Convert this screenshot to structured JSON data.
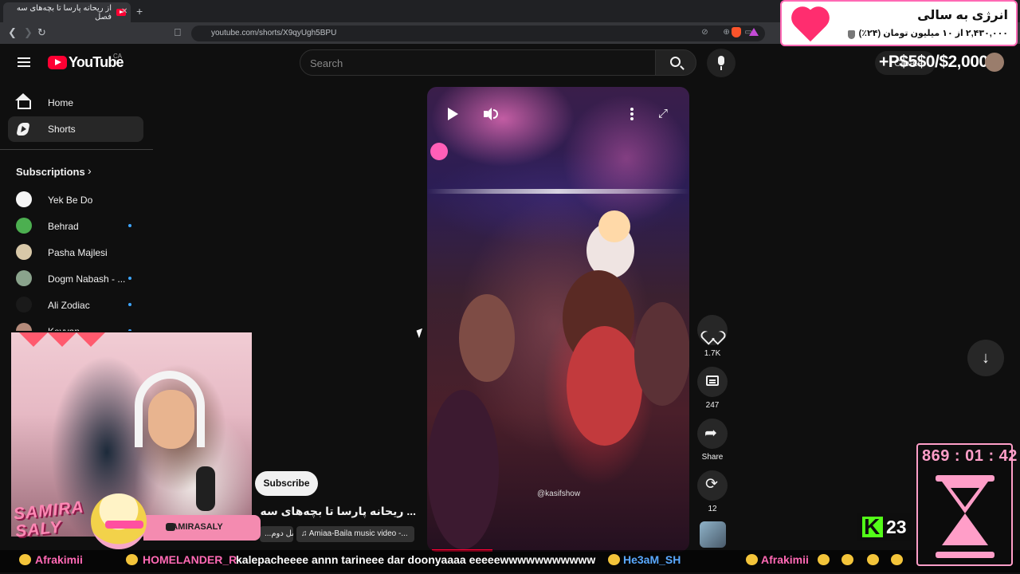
{
  "browser": {
    "tab_title": "از ریحانه پارسا تا بچه‌های سه فصل",
    "new_tab": "+",
    "url": "youtube.com/shorts/X9qyUgh5BPU"
  },
  "masthead": {
    "logo_text": "YouTube",
    "region": "CA",
    "search_placeholder": "Search",
    "create_label": "Create",
    "overlay_amount": "+P$5$0/$2,000"
  },
  "sidebar": {
    "items": [
      {
        "label": "Home"
      },
      {
        "label": "Shorts"
      }
    ],
    "subscriptions_label": "Subscriptions",
    "subscriptions": [
      {
        "name": "Yek Be Do",
        "color": "#f5f5f5",
        "new": false
      },
      {
        "name": "Behrad",
        "color": "#4caf50",
        "new": true
      },
      {
        "name": "Pasha Majlesi",
        "color": "#d8c8a8",
        "new": false
      },
      {
        "name": "Dogm Nabash - ...",
        "color": "#8aa38c",
        "new": true
      },
      {
        "name": "Ali Zodiac",
        "color": "#1a1a1a",
        "new": true
      },
      {
        "name": "Keyvan",
        "color": "#b48a7a",
        "new": true
      }
    ]
  },
  "short": {
    "watermark": "@kasifshow",
    "progress": 0.24,
    "likes": "1.7K",
    "comments": "247",
    "share_label": "Share",
    "remix_count": "12",
    "subscribe_label": "Subscribe",
    "title": "... ریحانه پارسا تا بچه‌های سه فصل",
    "chip_channel": "...سل دوم",
    "chip_music": "Amiaa-Baila music video -..."
  },
  "donation": {
    "title": "انرژی به سالی",
    "subtitle": "۲,۴۳۰,۰۰۰ از ۱۰ میلیون تومان (۲۴٪)"
  },
  "stream": {
    "streamer_name_line1": "SAMIRA",
    "streamer_name_line2": "SALY",
    "social_handle": "SAMIRASALY",
    "kick_followers": "23",
    "timer": "869 : 01 : 42"
  },
  "chat_ticker": [
    {
      "user": "Afrakimii",
      "color": "#ff69b4",
      "message": ""
    },
    {
      "user": "HOMELANDER_R",
      "color": "#ff69b4",
      "message": "kalepacheeee annn tarineee dar doonyaaaa eeeeewwwwwwwwwww"
    },
    {
      "user": "He3aM_SH",
      "color": "#5aa9ff",
      "message": ""
    },
    {
      "user": "Afrakimii",
      "color": "#ff69b4",
      "message": ""
    }
  ],
  "colors": {
    "brand_red": "#ff0033",
    "background": "#0f0f0f",
    "accent_pink": "#ff9ec8"
  }
}
